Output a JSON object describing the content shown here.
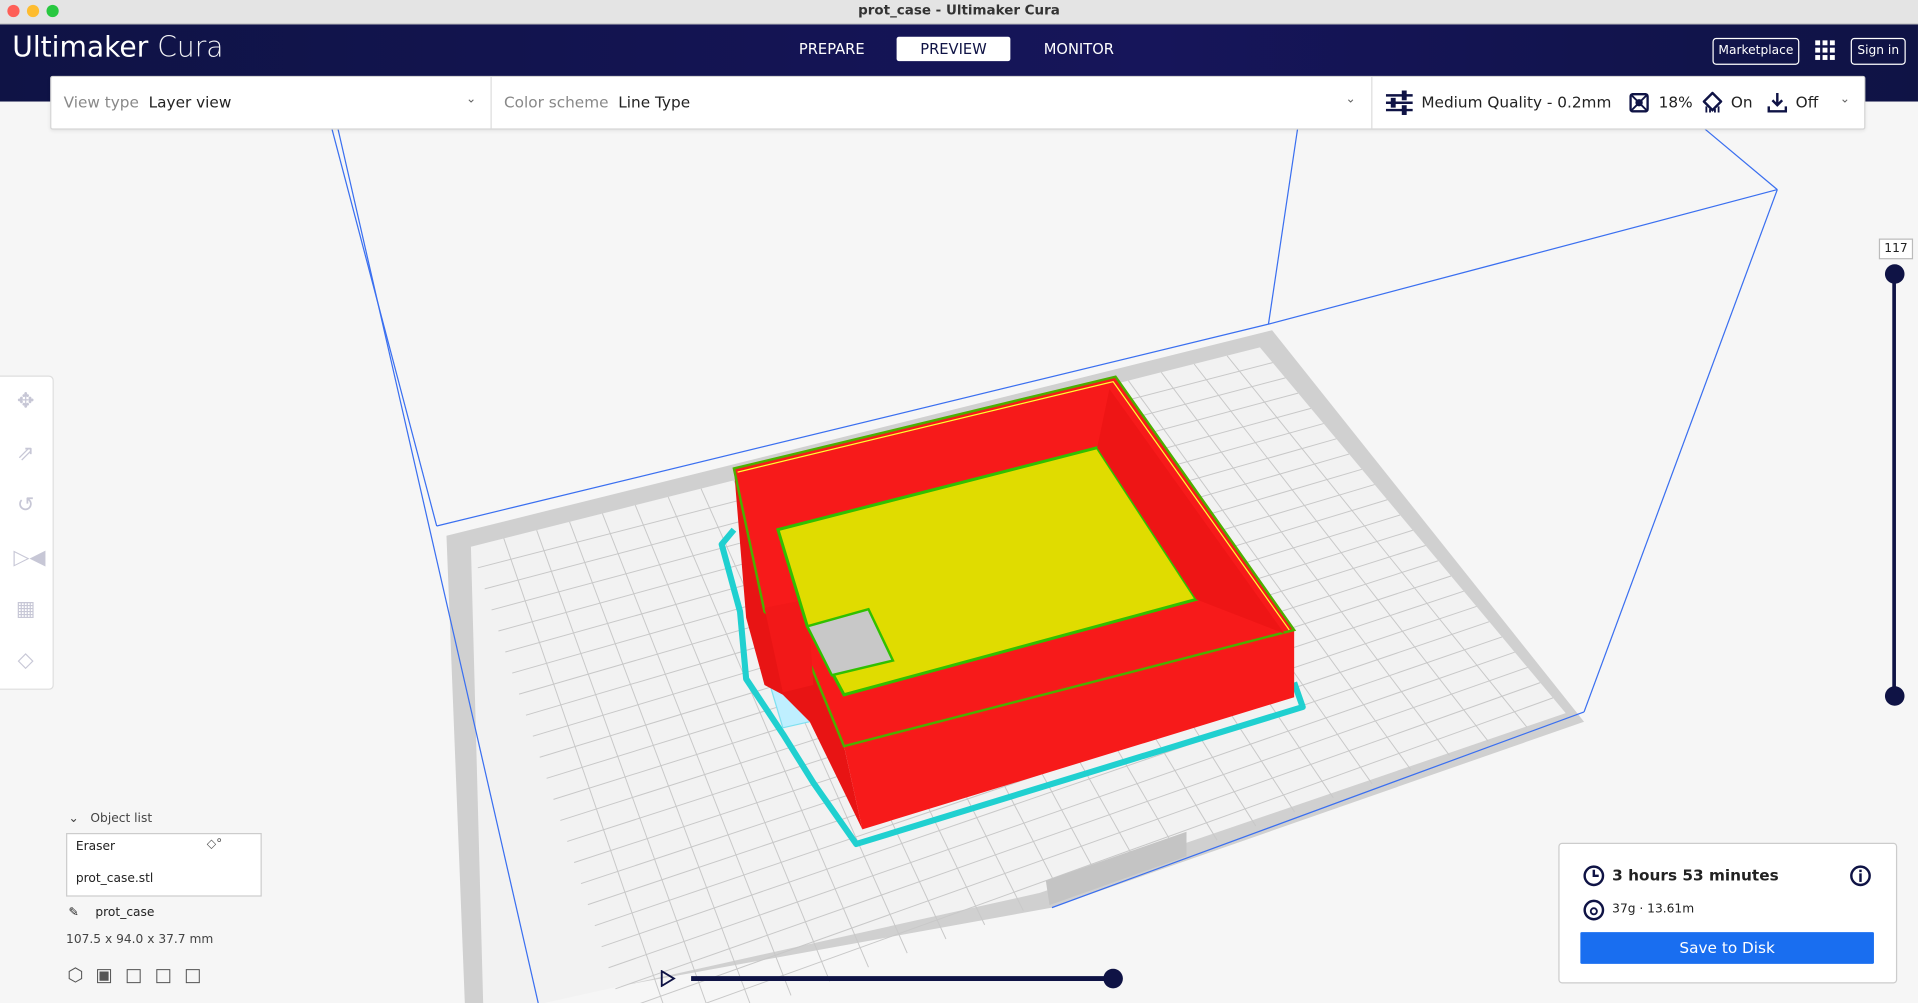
{
  "window": {
    "title": "prot_case - Ultimaker Cura"
  },
  "header": {
    "logo_bold": "Ultimaker",
    "logo_light": "Cura",
    "tabs": [
      {
        "label": "PREPARE"
      },
      {
        "label": "PREVIEW",
        "active": true
      },
      {
        "label": "MONITOR"
      }
    ],
    "marketplace_label": "Marketplace",
    "sign_in_label": "Sign in"
  },
  "toolbar": {
    "view_type_label": "View type",
    "view_type_value": "Layer view",
    "color_scheme_label": "Color scheme",
    "color_scheme_value": "Line Type",
    "quality": "Medium Quality - 0.2mm",
    "infill": "18%",
    "support": "On",
    "adhesion": "Off"
  },
  "left_tools": [
    "move-icon",
    "scale-icon",
    "rotate-icon",
    "mirror-icon",
    "per-model-settings-icon",
    "support-blocker-icon"
  ],
  "layer_slider": {
    "current_layer": "117",
    "value_fraction": 1.0
  },
  "playback": {
    "progress_fraction": 1.0
  },
  "object_list": {
    "header": "Object list",
    "items": [
      {
        "name": "Eraser"
      },
      {
        "name": "prot_case.stl"
      }
    ],
    "selected_name": "prot_case",
    "dimensions": "107.5 x 94.0 x 37.7 mm"
  },
  "print_info": {
    "time": "3 hours 53 minutes",
    "material": "37g · 13.61m",
    "save_label": "Save to Disk"
  },
  "colors": {
    "header": "#12134a",
    "accent": "#196ef0",
    "wall": "#f71a1a",
    "infill": "#e6e600",
    "skirt": "#20d0d0",
    "build_volume": "#3a6ff0"
  }
}
